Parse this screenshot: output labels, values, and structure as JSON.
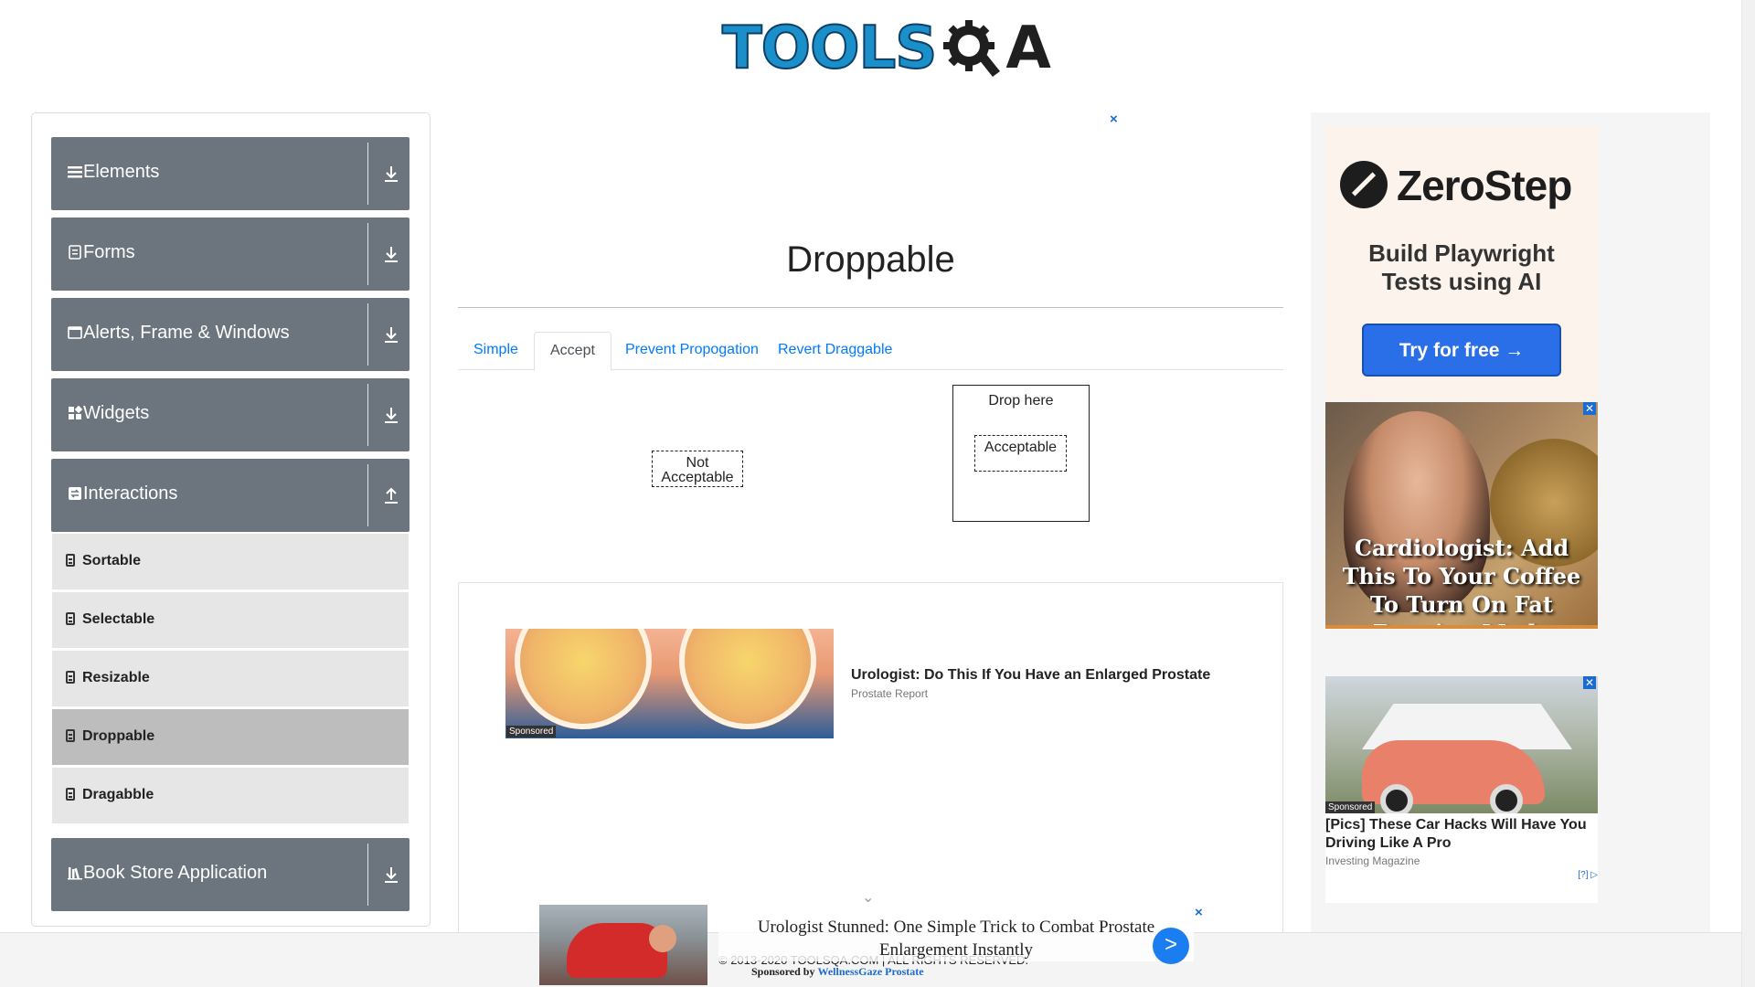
{
  "header": {
    "logo_text": "TOOLS",
    "logo_text_tail": "A"
  },
  "sidebar": {
    "groups": [
      {
        "label": "Elements"
      },
      {
        "label": "Forms"
      },
      {
        "label": "Alerts, Frame & Windows"
      },
      {
        "label": "Widgets"
      },
      {
        "label": "Interactions"
      },
      {
        "label": "Book Store Application"
      }
    ],
    "interactions_items": [
      {
        "label": "Sortable"
      },
      {
        "label": "Selectable"
      },
      {
        "label": "Resizable"
      },
      {
        "label": "Droppable",
        "active": true
      },
      {
        "label": "Dragabble"
      }
    ]
  },
  "main": {
    "ad_close": "×",
    "title": "Droppable",
    "tabs": [
      {
        "label": "Simple"
      },
      {
        "label": "Accept",
        "active": true
      },
      {
        "label": "Prevent Propogation"
      },
      {
        "label": "Revert Draggable"
      }
    ],
    "not_acceptable_line1": "Not",
    "not_acceptable_line2": "Acceptable",
    "drop_here": "Drop here",
    "acceptable": "Acceptable"
  },
  "center_ad": {
    "sponsored": "Sponsored",
    "headline": "Urologist: Do This If You Have an Enlarged Prostate",
    "source": "Prostate Report",
    "chevron": "⌄"
  },
  "right_ads": {
    "zerostep": {
      "name": "ZeroStep",
      "tagline_line1": "Build Playwright",
      "tagline_line2": "Tests using AI",
      "button": "Try for free →"
    },
    "cardio": {
      "close": "✕",
      "caption": "Cardiologist: Add This To Your Coffee To Turn On Fat Burning Mode"
    },
    "car": {
      "close": "✕",
      "sponsored": "Sponsored",
      "headline": "[Pics] These Car Hacks Will Have You Driving Like A Pro",
      "source": "Investing Magazine",
      "adchoice": "[?] ▷"
    }
  },
  "bottom_ad": {
    "text": "Urologist Stunned: One Simple Trick to Combat Prostate Enlargement Instantly",
    "sponsored_prefix": "Sponsored by ",
    "sponsored_by": "WellnessGaze Prostate",
    "go": ">",
    "close": "×"
  },
  "footer": {
    "copyright": "© 2013-2020 TOOLSQA.COM | ALL RIGHTS RESERVED."
  },
  "colors": {
    "accent": "#007bff",
    "sidebar_group": "#6c757d",
    "sidebar_sub": "#e6e6e6",
    "sidebar_active": "#bdbdbd"
  }
}
